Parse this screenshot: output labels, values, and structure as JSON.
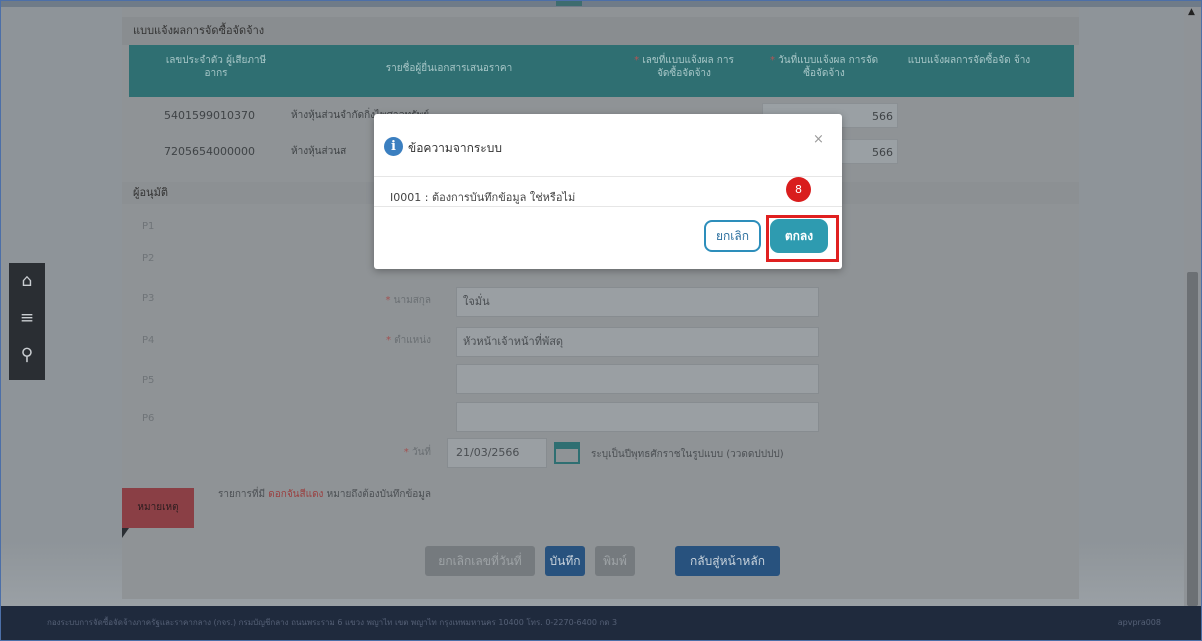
{
  "section": {
    "title": "แบบแจ้งผลการจัดซื้อจัดจ้าง",
    "headers": [
      {
        "text": "เลขประจำตัว ผู้เสียภาษีอากร",
        "required": false
      },
      {
        "text": "รายชื่อผู้ยื่นเอกสารเสนอราคา",
        "required": false
      },
      {
        "text": "เลขที่แบบแจ้งผล การจัดซื้อจัดจ้าง",
        "required": true
      },
      {
        "text": "วันที่แบบแจ้งผล การจัดซื้อจัดจ้าง",
        "required": true
      },
      {
        "text": "แบบแจ้งผลการจัดซื้อจัด จ้าง",
        "required": false
      }
    ],
    "rows": [
      {
        "tax_id": "5401599010370",
        "name": "ห้างหุ้นส่วนจำกัดกิ่งไพศาลทรัพย์",
        "date": "566"
      },
      {
        "tax_id": "7205654000000",
        "name": "ห้างหุ้นส่วนส",
        "date": "566"
      }
    ]
  },
  "approver": {
    "title": "ผู้อนุมัติ",
    "p_labels": [
      "P1",
      "P2",
      "P3",
      "P4",
      "P5",
      "P6"
    ],
    "lastname_label": "นามสกุล",
    "lastname_value": "ใจมั่น",
    "position_label": "ตำแหน่ง",
    "position_value": "หัวหน้าเจ้าหน้าที่พัสดุ",
    "date_label": "วันที่",
    "date_value": "21/03/2566",
    "date_hint": "ระบุเป็นปีพุทธศักราชในรูปแบบ (ววดดปปปป)"
  },
  "note": {
    "tag": "หมายเหตุ",
    "text_before": "รายการที่มี",
    "text_red": "ดอกจันสีแดง",
    "text_after": "หมายถึงต้องบันทึกข้อมูล"
  },
  "buttons": {
    "cancel_number": "ยกเลิกเลขที่วันที่",
    "save": "บันทึก",
    "print": "พิมพ์",
    "back": "กลับสู่หน้าหลัก"
  },
  "footer": {
    "left": "กองระบบการจัดซื้อจัดจ้างภาครัฐและราคากลาง (กจร.) กรมบัญชีกลาง ถนนพระราม 6 แขวง พญาไท เขต พญาไท กรุงเทพมหานคร 10400 โทร. 0-2270-6400 กด 3",
    "right": "apvpra008"
  },
  "modal": {
    "title": "ข้อความจากระบบ",
    "message": "I0001 : ต้องการบันทึกข้อมูล ใช่หรือไม่",
    "cancel": "ยกเลิก",
    "ok": "ตกลง",
    "close": "×",
    "step": "8"
  },
  "colors": {
    "teal": "#2e9bb0",
    "highlight": "#e02020",
    "info": "#3b7fc0"
  }
}
